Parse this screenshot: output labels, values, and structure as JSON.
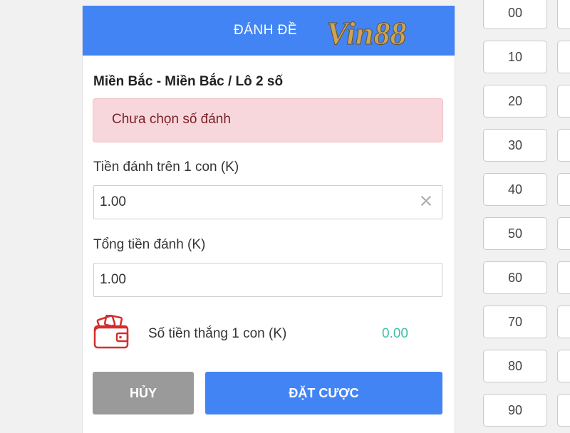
{
  "header": {
    "title": "ĐÁNH ĐỀ",
    "logo_text": "Vin88"
  },
  "market": "Miền Bắc - Miền Bắc / Lô 2 số",
  "alert": "Chưa chọn số đánh",
  "bet_per_number": {
    "label": "Tiền đánh trên 1 con (K)",
    "value": "1.00"
  },
  "total_bet": {
    "label": "Tổng tiền đánh (K)",
    "value": "1.00"
  },
  "win_per_number": {
    "label": "Số tiền thắng 1 con (K)",
    "value": "0.00"
  },
  "buttons": {
    "cancel": "HỦY",
    "submit": "ĐẶT CƯỢC"
  },
  "numbers": [
    "00",
    "10",
    "20",
    "30",
    "40",
    "50",
    "60",
    "70",
    "80",
    "90"
  ],
  "icons": {
    "wallet": "wallet-icon",
    "clear": "close-icon"
  },
  "colors": {
    "primary": "#4384f5",
    "cancel": "#9a9a9a",
    "alert_bg": "#f7d7db",
    "win_value": "#3fbfa8",
    "logo_red": "#d32f2f"
  }
}
